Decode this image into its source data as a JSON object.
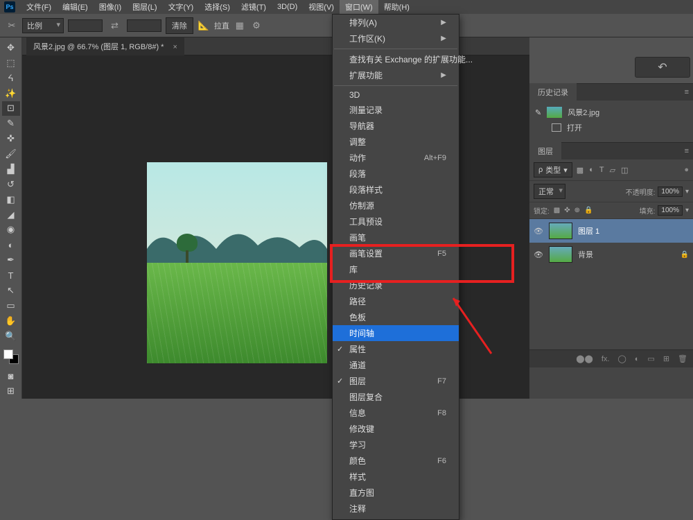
{
  "app": {
    "logo": "Ps"
  },
  "menubar": [
    "文件(F)",
    "编辑(E)",
    "图像(I)",
    "图层(L)",
    "文字(Y)",
    "选择(S)",
    "滤镜(T)",
    "3D(D)",
    "视图(V)",
    "窗口(W)",
    "帮助(H)"
  ],
  "menubar_open_index": 9,
  "optbar": {
    "ratio_label": "比例",
    "clear_label": "清除",
    "straighten_label": "拉直"
  },
  "tab": {
    "title": "风景2.jpg @ 66.7% (图层 1, RGB/8#) *",
    "close": "×"
  },
  "dropdown": {
    "items": [
      {
        "label": "排列(A)",
        "arrow": true
      },
      {
        "label": "工作区(K)",
        "arrow": true
      },
      {
        "sep": true
      },
      {
        "label": "查找有关 Exchange 的扩展功能..."
      },
      {
        "label": "扩展功能",
        "arrow": true
      },
      {
        "sep": true
      },
      {
        "label": "3D"
      },
      {
        "label": "测量记录"
      },
      {
        "label": "导航器"
      },
      {
        "label": "调整"
      },
      {
        "label": "动作",
        "shortcut": "Alt+F9"
      },
      {
        "label": "段落"
      },
      {
        "label": "段落样式"
      },
      {
        "label": "仿制源"
      },
      {
        "label": "工具预设"
      },
      {
        "label": "画笔"
      },
      {
        "label": "画笔设置",
        "shortcut": "F5"
      },
      {
        "label": "库"
      },
      {
        "label": "历史记录"
      },
      {
        "label": "路径"
      },
      {
        "label": "色板"
      },
      {
        "label": "时间轴",
        "highlight": true
      },
      {
        "label": "属性",
        "check": true
      },
      {
        "label": "通道"
      },
      {
        "label": "图层",
        "shortcut": "F7",
        "check": true
      },
      {
        "label": "图层复合"
      },
      {
        "label": "信息",
        "shortcut": "F8"
      },
      {
        "label": "修改键"
      },
      {
        "label": "学习"
      },
      {
        "label": "颜色",
        "shortcut": "F6"
      },
      {
        "label": "样式"
      },
      {
        "label": "直方图"
      },
      {
        "label": "注释"
      }
    ]
  },
  "history_panel": {
    "tab": "历史记录",
    "file": "风景2.jpg",
    "step": "打开"
  },
  "layers_panel": {
    "tab": "图层",
    "kind_label": "类型",
    "blend": "正常",
    "opacity_label": "不透明度:",
    "opacity_val": "100%",
    "lock_label": "锁定:",
    "fill_label": "填充:",
    "fill_val": "100%",
    "layers": [
      {
        "name": "图层 1",
        "selected": true
      },
      {
        "name": "背景",
        "locked": true
      }
    ]
  }
}
